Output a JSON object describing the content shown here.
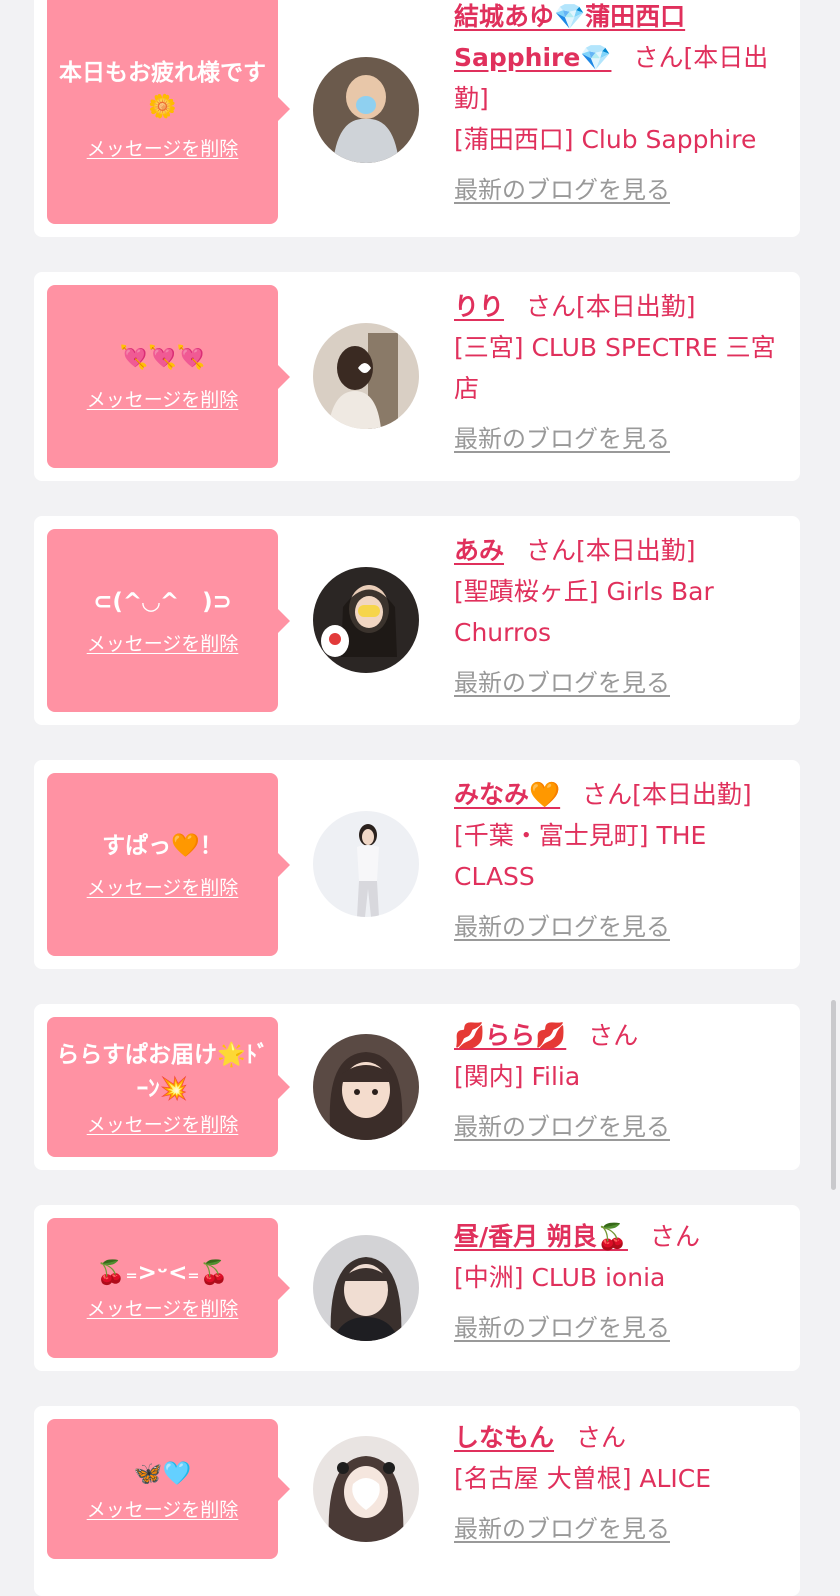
{
  "common": {
    "delete_label": "メッセージを削除",
    "blog_label": "最新のブログを見る",
    "honorific": "さん"
  },
  "colors": {
    "bubble": "#ff92a3",
    "accent": "#e0305c",
    "muted": "#999999",
    "background": "#f2f2f4"
  },
  "messages": [
    {
      "message": "本日もお疲れ様です🌼",
      "name": "結城あゆ💎蒲田西口Sapphire💎",
      "status": "[本日出勤]",
      "shop": "[蒲田西口] Club Sapphire"
    },
    {
      "message": "💘💘💘",
      "name": "りり",
      "status": "[本日出勤]",
      "shop": "[三宮] CLUB SPECTRE 三宮店"
    },
    {
      "message": "⊂(^◡^　)⊃",
      "name": "あみ",
      "status": "[本日出勤]",
      "shop": "[聖蹟桜ヶ丘] Girls Bar Churros"
    },
    {
      "message": "すぱっ🧡！",
      "name": "みなみ🧡",
      "status": "[本日出勤]",
      "shop": "[千葉・富士見町] THE CLASS"
    },
    {
      "message": "ららすぱお届け🌟ﾄﾞｰﾝ💥",
      "name": "💋らら💋",
      "status": "",
      "shop": "[関内] Filia"
    },
    {
      "message": "🍒₌>ᵕ<₌🍒",
      "name": "昼/香月 朔良🍒",
      "status": "",
      "shop": "[中洲] CLUB ionia"
    },
    {
      "message": "🦋🩵",
      "name": "しなもん",
      "status": "",
      "shop": "[名古屋 大曽根] ALICE"
    }
  ]
}
